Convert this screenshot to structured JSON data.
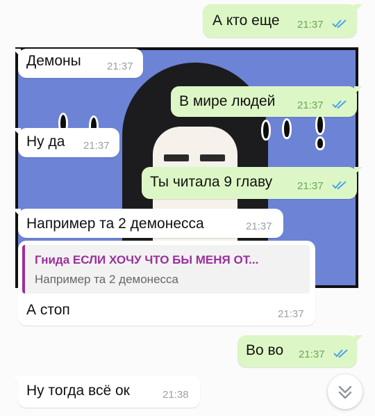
{
  "messages": [
    {
      "id": "m1",
      "dir": "out",
      "text": "А кто еще",
      "time": "21:37",
      "read": true
    },
    {
      "id": "m2",
      "dir": "in",
      "text": "Демоны",
      "time": "21:37"
    },
    {
      "id": "m3",
      "dir": "out",
      "text": "В мире людей",
      "time": "21:37",
      "read": true
    },
    {
      "id": "m4",
      "dir": "in",
      "text": "Ну да",
      "time": "21:37"
    },
    {
      "id": "m5",
      "dir": "out",
      "text": "Ты читала 9 главу",
      "time": "21:37",
      "read": true
    },
    {
      "id": "m6",
      "dir": "in",
      "text": "Например та 2 демонесса",
      "time": "21:37"
    },
    {
      "id": "m7",
      "dir": "in",
      "text": "А стоп",
      "time": "21:37",
      "reply": {
        "author": "Гнида ЕСЛИ ХОЧУ ЧТО БЫ МЕНЯ ОТ...",
        "text": "Например та 2 демонесса"
      }
    },
    {
      "id": "m8",
      "dir": "out",
      "text": "Во во",
      "time": "21:37",
      "read": true
    },
    {
      "id": "m9",
      "dir": "in",
      "text": "Ну тогда всё ок",
      "time": "21:38"
    }
  ],
  "colors": {
    "outgoing_bubble": "#dcf7c5",
    "incoming_bubble": "#ffffff",
    "read_check": "#4aa3e8",
    "reply_accent": "#9a2f9c"
  },
  "icons": {
    "read_receipt": "double-check-icon",
    "scroll_down": "chevron-double-down-icon"
  }
}
